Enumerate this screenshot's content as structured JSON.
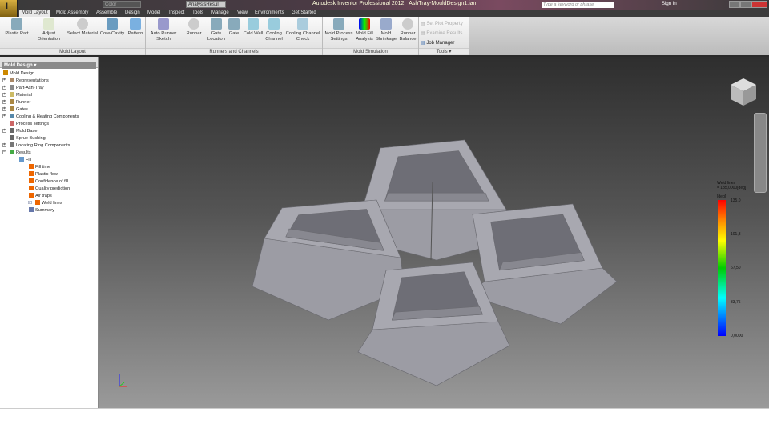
{
  "titlebar": {
    "app_letter": "I",
    "style_combo": "Color",
    "analysis_combo": "AnalysisResul",
    "title": "Autodesk Inventor Professional 2012",
    "document": "AshTray-MouldDesign1.iam",
    "search_placeholder": "Type a keyword or phrase",
    "signin": "Sign In"
  },
  "tabs": [
    "Mold Layout",
    "Mold Assembly",
    "Assemble",
    "Design",
    "Model",
    "Inspect",
    "Tools",
    "Manage",
    "View",
    "Environments",
    "Get Started"
  ],
  "ribbon": {
    "mold_layout": {
      "label": "Mold Layout",
      "buttons": [
        "Plastic Part",
        "Adjust Orientation",
        "Select Material",
        "Core/Cavity",
        "Pattern"
      ]
    },
    "runners": {
      "label": "Runners and Channels",
      "buttons": [
        "Auto Runner Sketch",
        "Runner",
        "Gate Location",
        "Gate",
        "Cold Well",
        "Cooling Channel",
        "Cooling Channel Check"
      ]
    },
    "simulation": {
      "label": "Mold Simulation",
      "buttons": [
        "Mold Process Settings",
        "Mold Fill Analysis",
        "Mold Shrinkage",
        "Runner Balance"
      ]
    },
    "tools": {
      "label": "Tools ▾",
      "items": [
        "Set Plot Property",
        "Examine Results",
        "Job Manager"
      ]
    }
  },
  "browser": {
    "title": "Mold Design ▾",
    "nodes": [
      "Mold Design",
      "Representations",
      "Part-Ash-Tray",
      "Material",
      "Runner",
      "Gates",
      "Cooling & Heating Components",
      "Process settings",
      "Mold Base",
      "Sprue Bushing",
      "Locating Ring Components",
      "Results",
      "Fill",
      "Fill time",
      "Plastic flow",
      "Confidence of fill",
      "Quality prediction",
      "Air traps",
      "Weld lines",
      "Summary"
    ]
  },
  "legend": {
    "title": "Weld lines",
    "value": "= 135,0000[deg]",
    "unit": "[deg]",
    "ticks": [
      "135,0",
      "101,3",
      "67,50",
      "33,75",
      "0,0000"
    ],
    "colors": [
      "#ff0000",
      "#ffff00",
      "#00cc00",
      "#00ffff",
      "#0000ff"
    ]
  }
}
